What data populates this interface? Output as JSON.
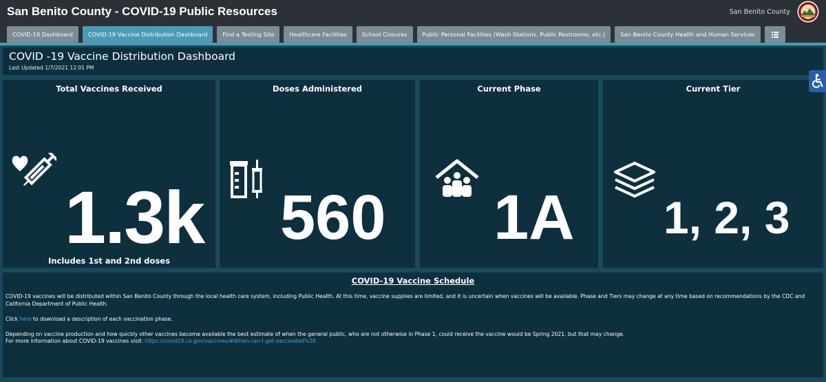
{
  "header": {
    "app_title": "San Benito County - COVID-19 Public Resources",
    "org_name": "San Benito County",
    "logo_icon": "county-seal-icon"
  },
  "tabs": [
    {
      "label": "COVID-19 Dashboard",
      "active": false
    },
    {
      "label": "COVID-19 Vaccine Distribution Dashboard",
      "active": true
    },
    {
      "label": "Find a Testing Site",
      "active": false
    },
    {
      "label": "Healthcare Facilities",
      "active": false
    },
    {
      "label": "School Closures",
      "active": false
    },
    {
      "label": "Public Personal Facilities (Wash Stations, Public Restrooms, etc.)",
      "active": false
    },
    {
      "label": "San Benito County Health and Human Services",
      "active": false
    }
  ],
  "tab_menu_icon": "list-menu-icon",
  "page": {
    "title": "COVID -19 Vaccine Distribution Dashboard",
    "last_updated": "Last Updated 1/7/2021 12:01 PM"
  },
  "cards": [
    {
      "title": "Total Vaccines Received",
      "value": "1.3k",
      "icon": "heart-syringe-icon",
      "footer": "Includes 1st and 2nd doses"
    },
    {
      "title": "Doses Administered",
      "value": "560",
      "icon": "vial-syringe-icon"
    },
    {
      "title": "Current Phase",
      "value": "1A",
      "icon": "house-people-icon"
    },
    {
      "title": "Current Tier",
      "value": "1, 2, 3",
      "icon": "layers-icon"
    }
  ],
  "schedule": {
    "title": "COVID-19 Vaccine Schedule",
    "paragraph1": "COVID-19 vaccines will be distributed within San Benito County through the local health care system, including Public Health. At this time, vaccine supplies are limited, and it is uncertain when vaccines will be available. Phase and Tiers may change at any time based on recommendations by the CDC and California Department of Public Health.",
    "click_prefix": "Click ",
    "click_link": "here",
    "click_suffix": " to download a description of each vaccination phase.",
    "paragraph3": "Depending on vaccine production and how quickly other vaccines become available the best estimate of when the general public, who are not otherwise in Phase 1, could receive the vaccine would be Spring 2021, but that may change.",
    "more_info_prefix": "For more information about COVID-19 vaccines visit: ",
    "more_info_link": "https://covid19.ca.gov/vaccines/#When-can-I-get-vaccinated%20"
  },
  "accessibility_icon": "accessibility-icon",
  "colors": {
    "header_bg": "#2b3137",
    "tab_bg": "#7c8b96",
    "tab_active_bg": "#4a9bb3",
    "page_bg": "#19495a",
    "panel_bg": "#0e2f3e",
    "link": "#4aa3d6",
    "accessibility_bg": "#2a5fa8"
  }
}
